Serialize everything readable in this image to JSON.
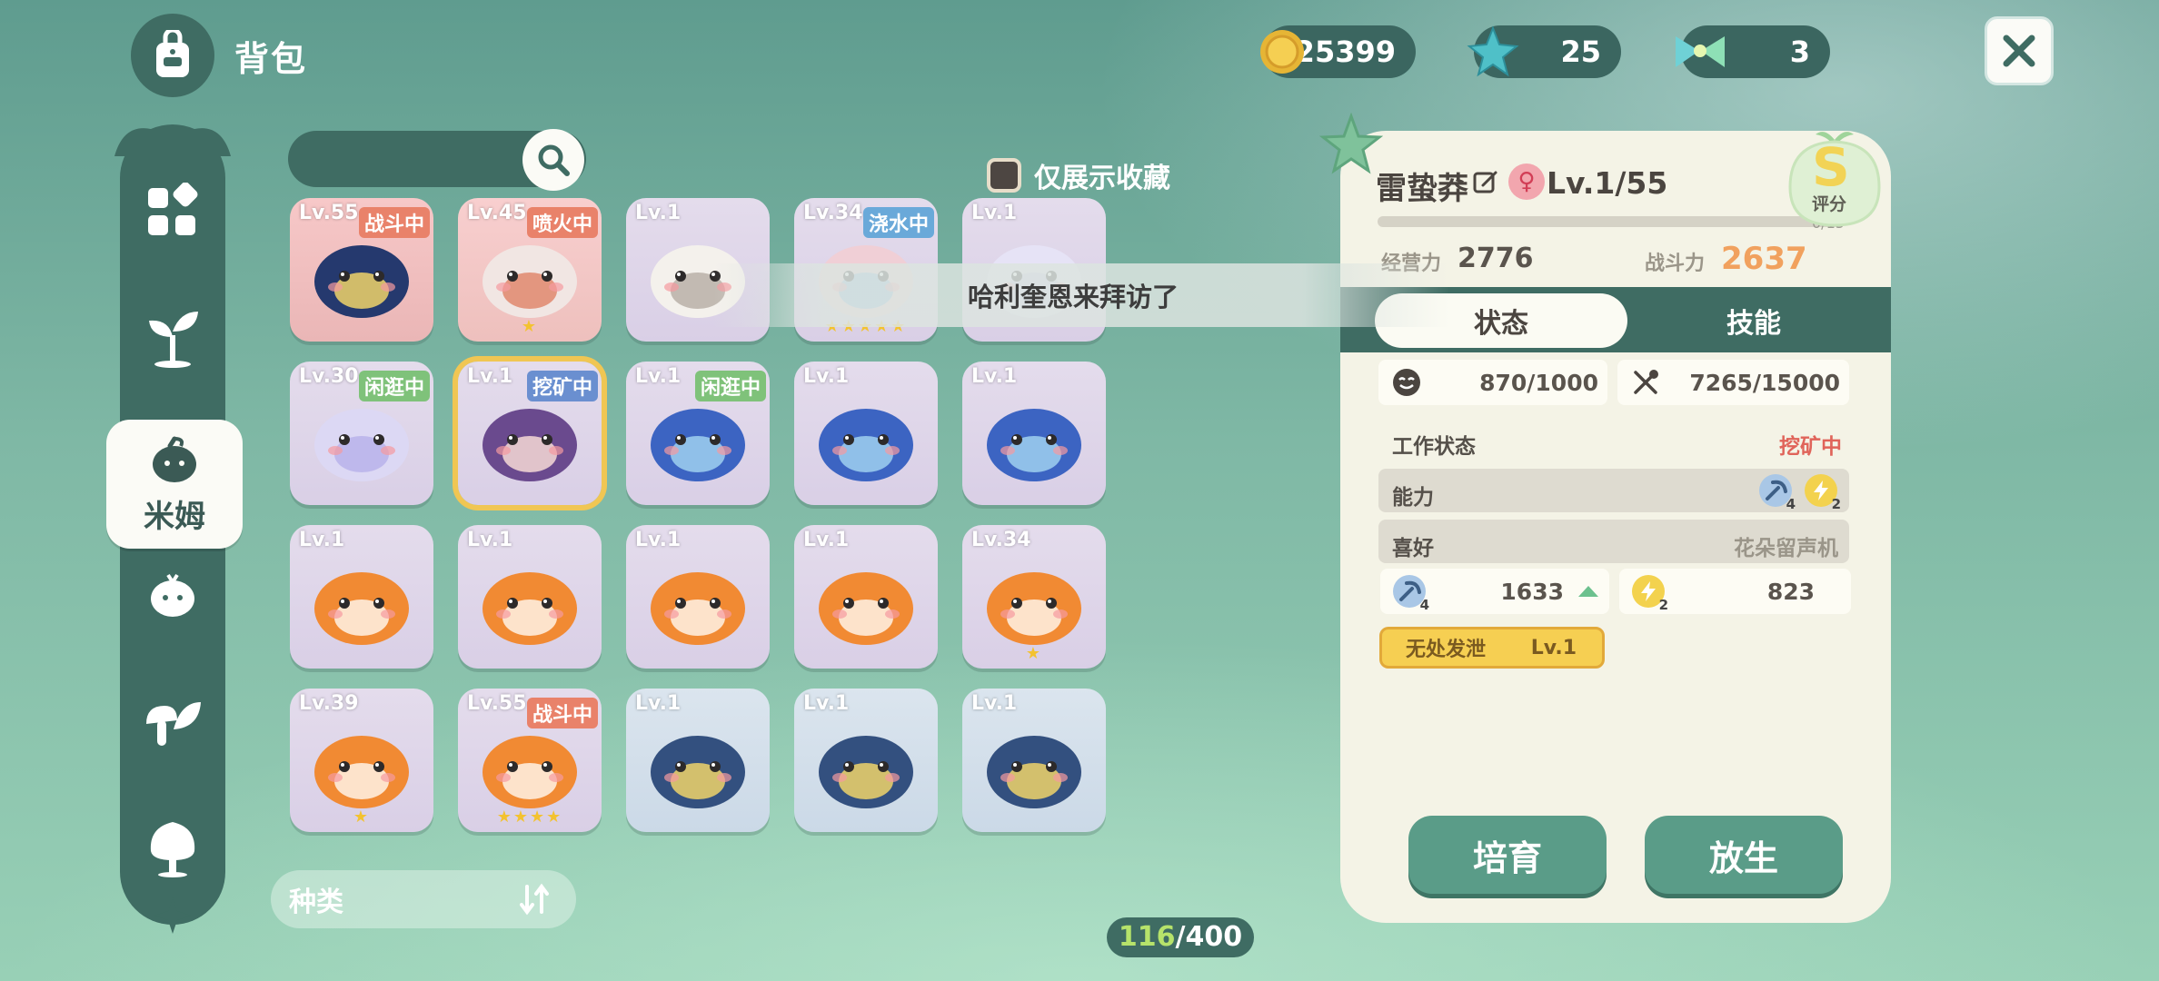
{
  "header": {
    "title": "背包",
    "resources": [
      {
        "name": "gold-coin",
        "value": "25399"
      },
      {
        "name": "star-crystal",
        "value": "25"
      },
      {
        "name": "crystal-bow",
        "value": "3"
      }
    ]
  },
  "sidebar": {
    "active_label": "米姆"
  },
  "filter": {
    "favorites_label": "仅展示收藏",
    "type_label": "种类"
  },
  "toast": "哈利奎恩来拜访了",
  "grid": {
    "cards": [
      {
        "lv": "Lv.55",
        "status": "战斗中",
        "st": "fight",
        "stars": ""
      },
      {
        "lv": "Lv.45",
        "status": "喷火中",
        "st": "fire",
        "stars": "★"
      },
      {
        "lv": "Lv.1",
        "status": "",
        "st": "",
        "stars": ""
      },
      {
        "lv": "Lv.34",
        "status": "浇水中",
        "st": "water",
        "stars": "★★★★★"
      },
      {
        "lv": "Lv.1",
        "status": "",
        "st": "",
        "stars": ""
      },
      {
        "lv": "Lv.30",
        "status": "闲逛中",
        "st": "idle",
        "stars": ""
      },
      {
        "lv": "Lv.1",
        "status": "挖矿中",
        "st": "mine",
        "stars": ""
      },
      {
        "lv": "Lv.1",
        "status": "闲逛中",
        "st": "idle",
        "stars": ""
      },
      {
        "lv": "Lv.1",
        "status": "",
        "st": "",
        "stars": ""
      },
      {
        "lv": "Lv.1",
        "status": "",
        "st": "",
        "stars": ""
      },
      {
        "lv": "Lv.1",
        "status": "",
        "st": "",
        "stars": ""
      },
      {
        "lv": "Lv.1",
        "status": "",
        "st": "",
        "stars": ""
      },
      {
        "lv": "Lv.1",
        "status": "",
        "st": "",
        "stars": ""
      },
      {
        "lv": "Lv.1",
        "status": "",
        "st": "",
        "stars": ""
      },
      {
        "lv": "Lv.34",
        "status": "",
        "st": "",
        "stars": "★"
      },
      {
        "lv": "Lv.39",
        "status": "",
        "st": "",
        "stars": "★"
      },
      {
        "lv": "Lv.55",
        "status": "战斗中",
        "st": "fight",
        "stars": "★★★★"
      },
      {
        "lv": "Lv.1",
        "status": "",
        "st": "",
        "stars": ""
      },
      {
        "lv": "Lv.1",
        "status": "",
        "st": "",
        "stars": ""
      },
      {
        "lv": "Lv.1",
        "status": "",
        "st": "",
        "stars": ""
      }
    ]
  },
  "count": {
    "current": "116",
    "max": "/400"
  },
  "detail": {
    "name": "雷蛰莽",
    "level": "Lv.1/55",
    "xp": "0/15",
    "grade_letter": "S",
    "grade_label": "评分",
    "manage_label": "经营力",
    "manage_value": "2776",
    "combat_label": "战斗力",
    "combat_value": "2637",
    "tab_status": "状态",
    "tab_skill": "技能",
    "mood": "870/1000",
    "food": "7265/15000",
    "work_label": "工作状态",
    "work_value": "挖矿中",
    "ability_label": "能力",
    "preference_label": "喜好",
    "preference_value": "花朵留声机",
    "mining_level": "4",
    "electric_level": "2",
    "mining_power": "1633",
    "electric_power": "823",
    "buff_name": "无处发泄",
    "buff_level": "Lv.1",
    "btn_train": "培育",
    "btn_release": "放生"
  },
  "colors": {
    "panel_bg": "#f4f3e6",
    "dark_teal": "#3f6c63",
    "accent_orange": "#f1a15e",
    "work_red": "#e0645a",
    "button_green": "#5a9c88"
  }
}
